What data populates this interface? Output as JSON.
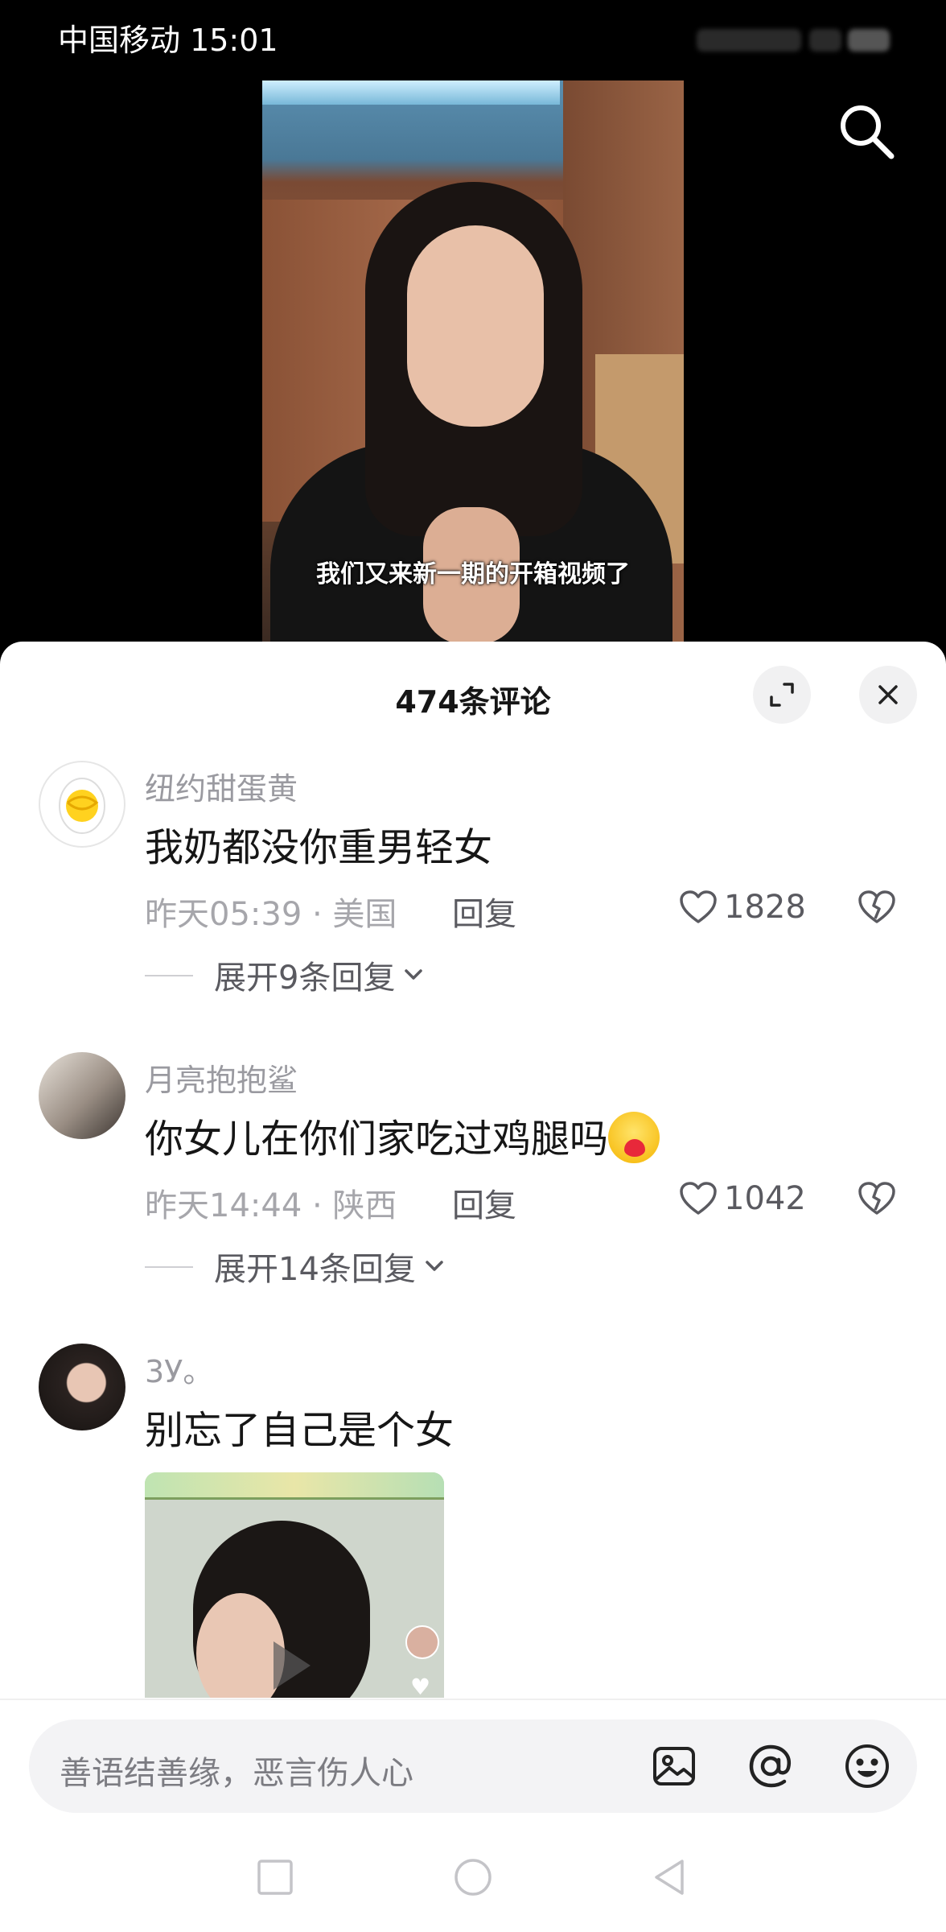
{
  "status_bar": {
    "carrier_time": "中国移动 15:01"
  },
  "video": {
    "caption": "我们又来新一期的开箱视频了",
    "search_icon": "search-icon"
  },
  "comments_sheet": {
    "title": "474条评论",
    "expand_icon": "expand-icon",
    "close_icon": "close-icon",
    "comments": [
      {
        "user": "纽约甜蛋黄",
        "text": "我奶都没你重男轻女",
        "meta": "昨天05:39 · 美国",
        "reply": "回复",
        "likes": "1828",
        "expand": "展开9条回复"
      },
      {
        "user": "月亮抱抱鲨",
        "text": "你女儿在你们家吃过鸡腿吗",
        "meta": "昨天14:44 · 陕西",
        "reply": "回复",
        "likes": "1042",
        "expand": "展开14条回复"
      },
      {
        "user": "3У。",
        "text": "别忘了自己是个女"
      }
    ]
  },
  "input_bar": {
    "placeholder": "善语结善缘，恶言伤人心",
    "icons": [
      "image-icon",
      "mention-icon",
      "emoji-icon"
    ]
  },
  "nav_bar": {
    "icons": [
      "recent-apps-icon",
      "home-icon",
      "back-icon"
    ]
  },
  "colors": {
    "text_primary": "#161616",
    "text_secondary": "#9a9aa0",
    "sheet_bg": "#ffffff",
    "video_bg": "#000000"
  }
}
